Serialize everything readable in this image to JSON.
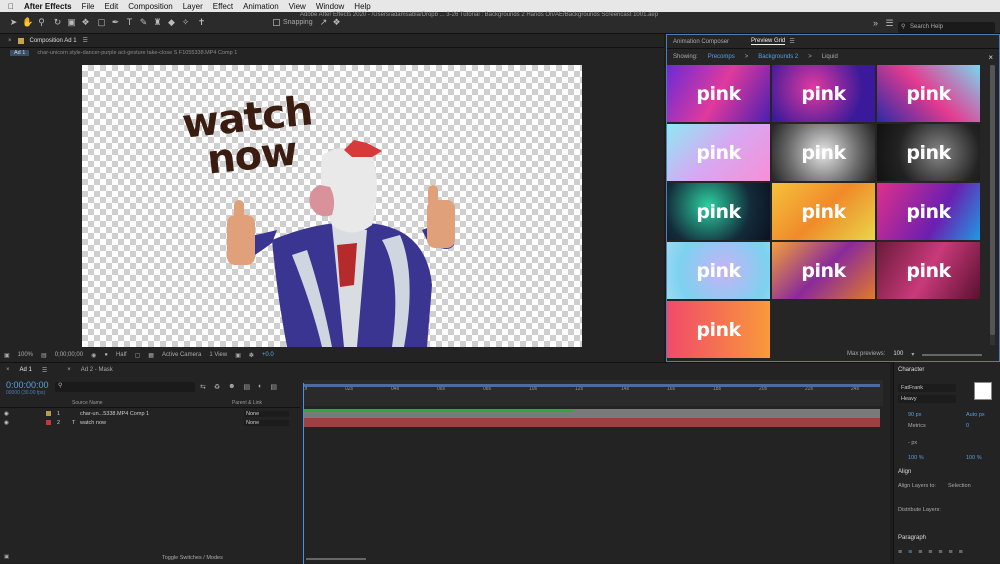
{
  "menubar": {
    "app": "After Effects",
    "items": [
      "File",
      "Edit",
      "Composition",
      "Layer",
      "Effect",
      "Animation",
      "View",
      "Window",
      "Help"
    ]
  },
  "toolbar": {
    "title": "Adobe After Effects 2020 - /Users/adamsabla/Dropb ... 3-26 Tutorial : Backgrounds 2 Hands On/AE/Backgrounds Screencast 1001.aep",
    "snapping": "Snapping",
    "search_placeholder": "Search Help"
  },
  "comp_panel": {
    "tab": "Composition Ad 1",
    "crumb_ad": "Ad 1",
    "crumb_path": "char-unicorn style-dancer-purple act-gesture take-close S F1055338.MP4 Comp 1",
    "canvas_text_1": "watch",
    "canvas_text_2": "now"
  },
  "viewer_bar": {
    "zoom": "100%",
    "timecode": "0;00;00;00",
    "resolution": "Half",
    "camera": "Active Camera",
    "views": "1 View",
    "exposure": "+0.0"
  },
  "preview_panel": {
    "tab_1": "Animation Composer",
    "tab_2": "Preview Grid",
    "showing_label": "Showing:",
    "crumb_1": "Precomps",
    "crumb_2": "Backgrounds 2",
    "crumb_3": "Liquid",
    "thumb_word": "pink",
    "max_label": "Max previews:",
    "max_value": "100"
  },
  "colors": {
    "accent": "#59a0e0",
    "panel_border": "#4c7fb4",
    "red_bar": "#9c4040",
    "green_bar": "#2aa83a"
  },
  "timeline": {
    "tab_1": "Ad 1",
    "tab_2": "Ad 2 - Mask",
    "time": "0:00:00:00",
    "fps": "00000 (30.00 fps)",
    "col_source": "Source Name",
    "col_parent": "Parent & Link",
    "layers": [
      {
        "num": "1",
        "name": "char-un...5338.MP4 Comp 1",
        "parent": "None"
      },
      {
        "num": "2",
        "name": "watch now",
        "parent": "None"
      }
    ],
    "ruler": [
      "0f",
      "02s",
      "04s",
      "06s",
      "08s",
      "10s",
      "12s",
      "14s",
      "16s",
      "18s",
      "20s",
      "22s",
      "24s"
    ],
    "toggle": "Toggle Switches / Modes"
  },
  "character": {
    "title": "Character",
    "font": "FatFrank",
    "style": "Heavy",
    "size": "90 px",
    "leading": "Auto px",
    "kerning": "Metrics",
    "tracking": "0",
    "stroke": "- px",
    "vscale": "100 %",
    "hscale": "100 %"
  },
  "align": {
    "title": "Align",
    "layers_to": "Align Layers to:",
    "selection": "Selection",
    "distribute": "Distribute Layers:"
  },
  "paragraph": {
    "title": "Paragraph"
  }
}
